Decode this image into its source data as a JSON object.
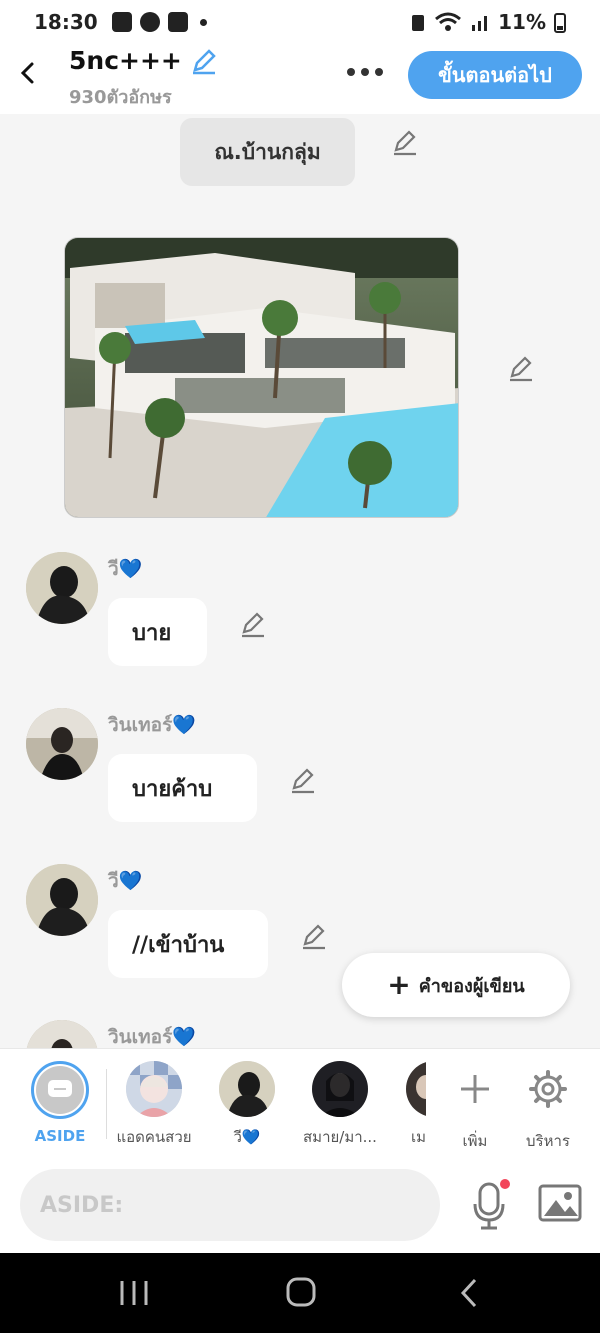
{
  "status": {
    "time": "18:30",
    "battery": "11%"
  },
  "header": {
    "title": "5nc+++",
    "subtitle": "930ตัวอักษร",
    "next_label": "ขั้นตอนต่อไป"
  },
  "chat": {
    "narration": "ณ.บ้านกลุ่ม",
    "messages": [
      {
        "name": "วี",
        "text": "บาย"
      },
      {
        "name": "วินเทอร์",
        "text": "บายค้าบ"
      },
      {
        "name": "วี",
        "text": "//เข้าบ้าน"
      },
      {
        "name": "วินเทอร์",
        "text": ""
      }
    ],
    "heart": "💙",
    "author_button": "คำของผู้เขียน"
  },
  "characters": {
    "items": [
      {
        "label": "ASIDE"
      },
      {
        "label": "แอดคนสวย"
      },
      {
        "label": "วี💙"
      },
      {
        "label": "สมาย/มา..."
      },
      {
        "label": "เม"
      }
    ],
    "add_label": "เพิ่ม",
    "manage_label": "บริหาร"
  },
  "input": {
    "placeholder": "ASIDE:"
  },
  "colors": {
    "accent": "#4fa3ef",
    "heart": "#1e9bf0"
  }
}
